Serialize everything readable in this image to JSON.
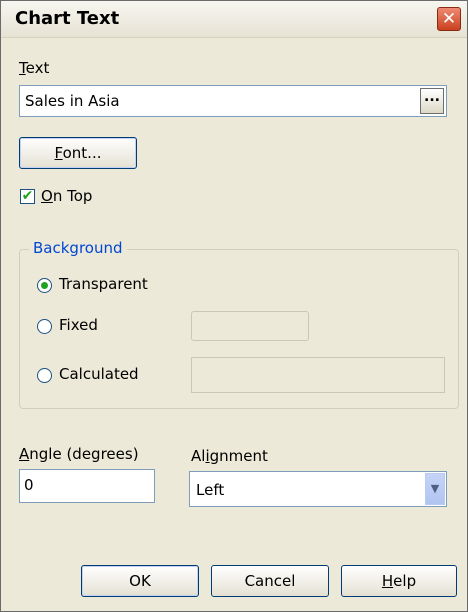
{
  "window": {
    "title": "Chart Text",
    "close_symbol": "✕"
  },
  "text_section": {
    "label_accel": "T",
    "label_rest": "ext",
    "value": "Sales in Asia",
    "browse_label": "..."
  },
  "font_button": {
    "accel": "F",
    "rest": "ont..."
  },
  "on_top": {
    "accel": "O",
    "rest": "n Top",
    "checked": true,
    "check_symbol": "✔"
  },
  "background": {
    "legend": "Background",
    "options": [
      {
        "label": "Transparent",
        "checked": true
      },
      {
        "label": "Fixed",
        "checked": false
      },
      {
        "label": "Calculated",
        "checked": false
      }
    ]
  },
  "angle": {
    "label_accel": "A",
    "label_rest": "ngle (degrees)",
    "value": "0"
  },
  "alignment": {
    "label_pre": "Al",
    "label_accel": "i",
    "label_rest": "gnment",
    "value": "Left",
    "arrow_symbol": "▼"
  },
  "buttons": {
    "ok": "OK",
    "cancel": "Cancel",
    "help_accel": "H",
    "help_rest": "elp"
  }
}
